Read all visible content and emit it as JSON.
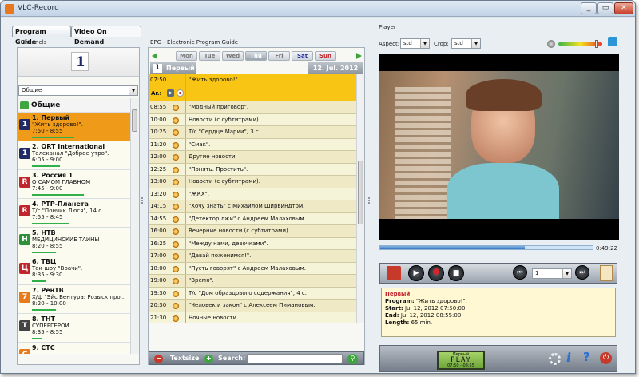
{
  "window": {
    "title": "VLC-Record",
    "buttons": [
      "_",
      "▭",
      "✕"
    ]
  },
  "tabs": [
    {
      "label": "Program Guide",
      "active": true
    },
    {
      "label": "Video On Demand",
      "active": false
    }
  ],
  "channels": {
    "title": "Channels",
    "logo_text": "1",
    "group_select": "Общие",
    "group_header": "Общие",
    "items": [
      {
        "name": "1. Первый",
        "program": "\"Жить здорово!\".",
        "time": "7:50 - 8:55",
        "icon_text": "1",
        "icon_color": "#1f2a66",
        "progress": 0.45,
        "selected": true
      },
      {
        "name": "2. ORT International",
        "program": "Телеканал \"Доброе утро\".",
        "time": "6:05 - 9:00",
        "icon_text": "1",
        "icon_color": "#1f2a66",
        "progress": 0.3,
        "selected": false
      },
      {
        "name": "3. Россия 1",
        "program": "О САМОМ ГЛАВНОМ",
        "time": "7:45 - 9:00",
        "icon_text": "R",
        "icon_color": "#c0262d",
        "progress": 0.55,
        "selected": false
      },
      {
        "name": "4. РТР-Планета",
        "program": "Т/с \"Пончик Люся\", 14 с.",
        "time": "7:55 - 8:45",
        "icon_text": "R",
        "icon_color": "#c0262d",
        "progress": 0.4,
        "selected": false
      },
      {
        "name": "5. НТВ",
        "program": "МЕДИЦИНСКИЕ ТАЙНЫ",
        "time": "8:20 - 8:55",
        "icon_text": "Н",
        "icon_color": "#2f8f3a",
        "progress": 0.25,
        "selected": false
      },
      {
        "name": "6. ТВЦ",
        "program": "Ток-шоу \"Врачи\".",
        "time": "8:35 - 9:30",
        "icon_text": "Ц",
        "icon_color": "#c0262d",
        "progress": 0.15,
        "selected": false
      },
      {
        "name": "7. РенТВ",
        "program": "Х/ф \"Эйс Вентура: Розыск про...",
        "time": "8:20 - 10:00",
        "icon_text": "7",
        "icon_color": "#e77a1b",
        "progress": 0.25,
        "selected": false
      },
      {
        "name": "8. ТНТ",
        "program": "СУПЕРГЕРОИ",
        "time": "8:35 - 8:55",
        "icon_text": "Т",
        "icon_color": "#444444",
        "progress": 0.1,
        "selected": false
      },
      {
        "name": "9. СТС",
        "program": "",
        "time": "",
        "icon_text": "С",
        "icon_color": "#e77a1b",
        "progress": 0.0,
        "selected": false
      }
    ]
  },
  "epg": {
    "title": "EPG - Electronic Program Guide",
    "days": [
      {
        "label": "Mon",
        "color": "#777"
      },
      {
        "label": "Tue",
        "color": "#777"
      },
      {
        "label": "Wed",
        "color": "#777"
      },
      {
        "label": "Thu",
        "color": "#fff"
      },
      {
        "label": "Fri",
        "color": "#777"
      },
      {
        "label": "Sat",
        "color": "#2430a0"
      },
      {
        "label": "Sun",
        "color": "#c0262d"
      }
    ],
    "channel_name": "Первый",
    "date": "12. Jul. 2012",
    "current": {
      "time": "07:50",
      "program": "\"Жить здорово!\".",
      "action_label": "Ar.:"
    },
    "rows": [
      {
        "time": "08:55",
        "program": "\"Модный приговор\"."
      },
      {
        "time": "10:00",
        "program": "Новости (с субтитрами)."
      },
      {
        "time": "10:25",
        "program": "Т/с \"Сердце Марии\", 3 с."
      },
      {
        "time": "11:20",
        "program": "\"Смак\"."
      },
      {
        "time": "12:00",
        "program": "Другие новости."
      },
      {
        "time": "12:25",
        "program": "\"Понять. Простить\"."
      },
      {
        "time": "13:00",
        "program": "Новости (с субтитрами)."
      },
      {
        "time": "13:20",
        "program": "\"ЖКХ\"."
      },
      {
        "time": "14:15",
        "program": "\"Хочу знать\" с Михаилом Ширвиндтом."
      },
      {
        "time": "14:55",
        "program": "\"Детектор лжи\" с Андреем Малаховым."
      },
      {
        "time": "16:00",
        "program": "Вечерние новости (с субтитрами)."
      },
      {
        "time": "16:25",
        "program": "\"Между нами, девочками\"."
      },
      {
        "time": "17:00",
        "program": "\"Давай поженимся!\"."
      },
      {
        "time": "18:00",
        "program": "\"Пусть говорят\" с Андреем Малаховым."
      },
      {
        "time": "19:00",
        "program": "\"Время\"."
      },
      {
        "time": "19:30",
        "program": "Т/с \"Дом образцового содержания\", 4 с."
      },
      {
        "time": "20:30",
        "program": "\"Человек и закон\" с Алексеем Пимановым."
      },
      {
        "time": "21:30",
        "program": "Ночные новости."
      }
    ],
    "textsize_label": "Textsize",
    "search_label": "Search:",
    "search_value": ""
  },
  "player": {
    "title": "Player",
    "aspect_label": "Aspect:",
    "aspect_value": "std",
    "crop_label": "Crop:",
    "crop_value": "std",
    "volume": 0.9,
    "elapsed_fraction": 0.68,
    "remaining_time": "0:49:22",
    "page_select": "1",
    "info": {
      "channel": "Первый",
      "program_label": "Program:",
      "program": "\"Жить здорово!\".",
      "start_label": "Start:",
      "start": "Jul 12, 2012 07:50:00",
      "end_label": "End:",
      "end": "Jul 12, 2012 08:55:00",
      "length_label": "Length:",
      "length": "65 min."
    },
    "lcd": {
      "channel": "Первый",
      "status": "PLAY",
      "time": "07:50 - 08:55"
    }
  },
  "colors": {
    "selected_channel": "#f09a1a",
    "current_program": "#f8c514",
    "progress": "#2fb04a"
  }
}
